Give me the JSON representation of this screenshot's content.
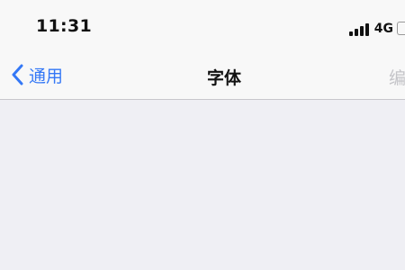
{
  "status_bar": {
    "time": "11:31",
    "network": "4G",
    "signal_bars": 4
  },
  "nav_bar": {
    "back_label": "通用",
    "title": "字体",
    "edit_label": "编"
  },
  "colors": {
    "accent": "#3478f6",
    "disabled": "#c4c4c8",
    "background": "#efeff4",
    "bar_background": "#f8f8f8"
  },
  "icons": {
    "back": "chevron-left-icon",
    "signal": "cellular-signal-icon",
    "battery": "battery-icon"
  }
}
